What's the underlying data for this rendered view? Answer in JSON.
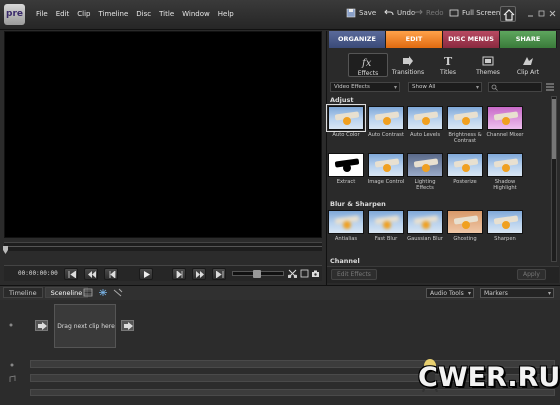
{
  "app": {
    "logo_text": "pre"
  },
  "menu": [
    "File",
    "Edit",
    "Clip",
    "Timeline",
    "Disc",
    "Title",
    "Window",
    "Help"
  ],
  "toolbar": {
    "save": "Save",
    "undo": "Undo",
    "redo": "Redo",
    "fullscreen": "Full Screen"
  },
  "monitor": {
    "timecode": "00:00:00:00"
  },
  "tabs": [
    "ORGANIZE",
    "EDIT",
    "DISC MENUS",
    "SHARE"
  ],
  "subtools": [
    "Effects",
    "Transitions",
    "Titles",
    "Themes",
    "Clip Art"
  ],
  "filters": {
    "category": "Video Effects",
    "show": "Show All"
  },
  "sections": {
    "adjust": "Adjust",
    "blur": "Blur & Sharpen",
    "channel": "Channel"
  },
  "effects_adjust_row1": [
    "Auto Color",
    "Auto Contrast",
    "Auto Levels",
    "Brightness & Contrast",
    "Channel Mixer"
  ],
  "effects_adjust_row2": [
    "Extract",
    "Image Control",
    "Lighting Effects",
    "Posterize",
    "Shadow Highlight"
  ],
  "effects_blur": [
    "Antialias",
    "Fast Blur",
    "Gaussian Blur",
    "Ghosting",
    "Sharpen"
  ],
  "panel_footer": {
    "edit_effects": "Edit Effects",
    "apply": "Apply"
  },
  "bottom": {
    "tab_timeline": "Timeline",
    "tab_sceneline": "Sceneline",
    "audio_tools": "Audio Tools",
    "markers": "Markers",
    "drop_hint": "Drag next clip here"
  },
  "watermark": "CWER.RU",
  "colors": {
    "organize": "#4a5a8a",
    "edit": "#f08020",
    "disc_menus": "#a03a52",
    "share": "#4a8e4a"
  }
}
